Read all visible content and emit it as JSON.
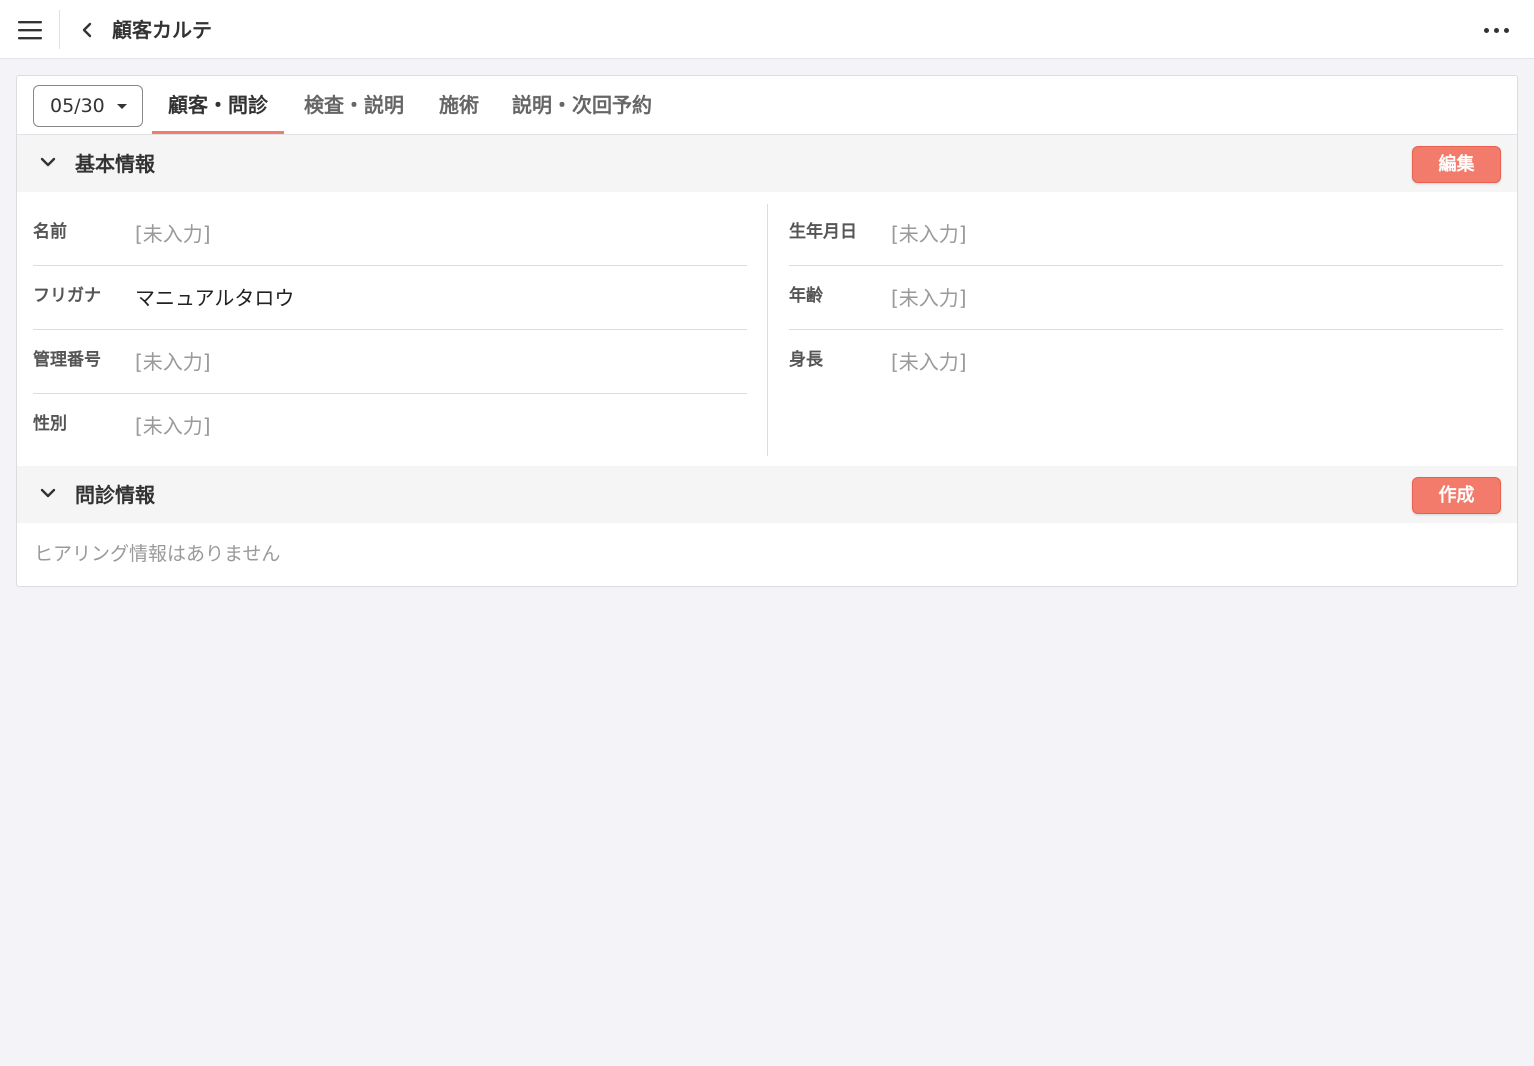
{
  "header": {
    "title": "顧客カルテ"
  },
  "tabs_bar": {
    "date_selected": "05/30",
    "tabs": [
      {
        "label": "顧客・問診",
        "active": true
      },
      {
        "label": "検査・説明",
        "active": false
      },
      {
        "label": "施術",
        "active": false
      },
      {
        "label": "説明・次回予約",
        "active": false
      }
    ]
  },
  "basic_info": {
    "title": "基本情報",
    "edit_label": "編集",
    "left_fields": [
      {
        "label": "名前",
        "value": "[未入力]"
      },
      {
        "label": "フリガナ",
        "value": "マニュアルタロウ"
      },
      {
        "label": "管理番号",
        "value": "[未入力]"
      },
      {
        "label": "性別",
        "value": "[未入力]"
      }
    ],
    "right_fields": [
      {
        "label": "生年月日",
        "value": "[未入力]"
      },
      {
        "label": "年齢",
        "value": "[未入力]"
      },
      {
        "label": "身長",
        "value": "[未入力]"
      }
    ]
  },
  "interview_info": {
    "title": "問診情報",
    "create_label": "作成",
    "empty_message": "ヒアリング情報はありません"
  },
  "colors": {
    "accent": "#f37b6b",
    "background": "#f4f4f8",
    "placeholder_text": "#9a9a9a"
  },
  "icons": {
    "menu": "hamburger-menu-icon",
    "back": "chevron-left-icon",
    "more": "more-horizontal-icon",
    "collapse": "chevron-down-icon",
    "dropdown": "caret-down-icon"
  }
}
